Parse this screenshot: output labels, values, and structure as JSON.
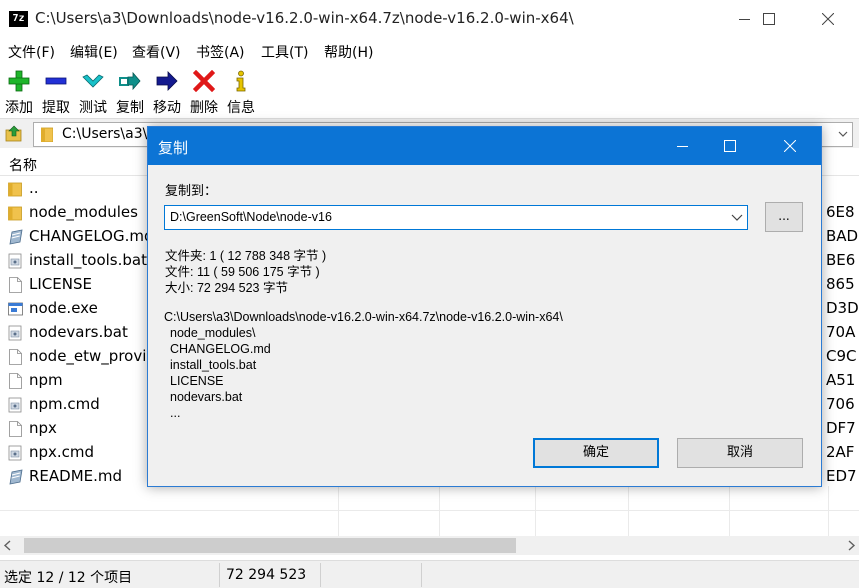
{
  "window": {
    "title": "C:\\Users\\a3\\Downloads\\node-v16.2.0-win-x64.7z\\node-v16.2.0-win-x64\\",
    "app_icon_text": "7z"
  },
  "menu": [
    "文件(F)",
    "编辑(E)",
    "查看(V)",
    "书签(A)",
    "工具(T)",
    "帮助(H)"
  ],
  "toolbar": [
    {
      "label": "添加",
      "icon": "plus-icon",
      "color": "#1fb52b"
    },
    {
      "label": "提取",
      "icon": "minus-icon",
      "color": "#2230d6"
    },
    {
      "label": "测试",
      "icon": "check-icon",
      "color": "#18c1c9"
    },
    {
      "label": "复制",
      "icon": "copy-arrow-icon",
      "color": "#0f8f8a"
    },
    {
      "label": "移动",
      "icon": "move-arrow-icon",
      "color": "#141a8f"
    },
    {
      "label": "删除",
      "icon": "delete-x-icon",
      "color": "#e01818"
    },
    {
      "label": "信息",
      "icon": "info-icon",
      "color": "#e6c400"
    }
  ],
  "address": {
    "path": "C:\\Users\\a3\\"
  },
  "list": {
    "header_name": "名称",
    "rows": [
      {
        "name": "..",
        "icon": "folder-icon",
        "crc": ""
      },
      {
        "name": "node_modules",
        "icon": "folder-icon",
        "crc": "6E8"
      },
      {
        "name": "CHANGELOG.md",
        "icon": "md-file-icon",
        "crc": "BAD"
      },
      {
        "name": "install_tools.bat",
        "icon": "bat-file-icon",
        "crc": "BE6"
      },
      {
        "name": "LICENSE",
        "icon": "blank-file-icon",
        "crc": "865"
      },
      {
        "name": "node.exe",
        "icon": "exe-file-icon",
        "crc": "D3D"
      },
      {
        "name": "nodevars.bat",
        "icon": "bat-file-icon",
        "crc": "70A"
      },
      {
        "name": "node_etw_provi",
        "icon": "blank-file-icon",
        "crc": "C9C"
      },
      {
        "name": "npm",
        "icon": "blank-file-icon",
        "crc": "A51"
      },
      {
        "name": "npm.cmd",
        "icon": "bat-file-icon",
        "crc": "706"
      },
      {
        "name": "npx",
        "icon": "blank-file-icon",
        "crc": "DF7"
      },
      {
        "name": "npx.cmd",
        "icon": "bat-file-icon",
        "crc": "2AF"
      },
      {
        "name": "README.md",
        "icon": "md-file-icon",
        "crc": "ED7"
      }
    ]
  },
  "status": {
    "selected": "选定 12 / 12 个项目",
    "size": "72 294 523"
  },
  "dialog": {
    "title": "复制",
    "copy_to_label": "复制到：",
    "destination": "D:\\GreenSoft\\Node\\node-v16",
    "browse_label": "...",
    "stats": [
      "文件夹: 1    ( 12 788 348 字节 )",
      "文件: 11    ( 59 506 175 字节 )",
      "大小: 72 294 523 字节"
    ],
    "source_path": "C:\\Users\\a3\\Downloads\\node-v16.2.0-win-x64.7z\\node-v16.2.0-win-x64\\",
    "source_items": [
      "node_modules\\",
      "CHANGELOG.md",
      "install_tools.bat",
      "LICENSE",
      "nodevars.bat",
      "..."
    ],
    "ok_label": "确定",
    "cancel_label": "取消"
  }
}
